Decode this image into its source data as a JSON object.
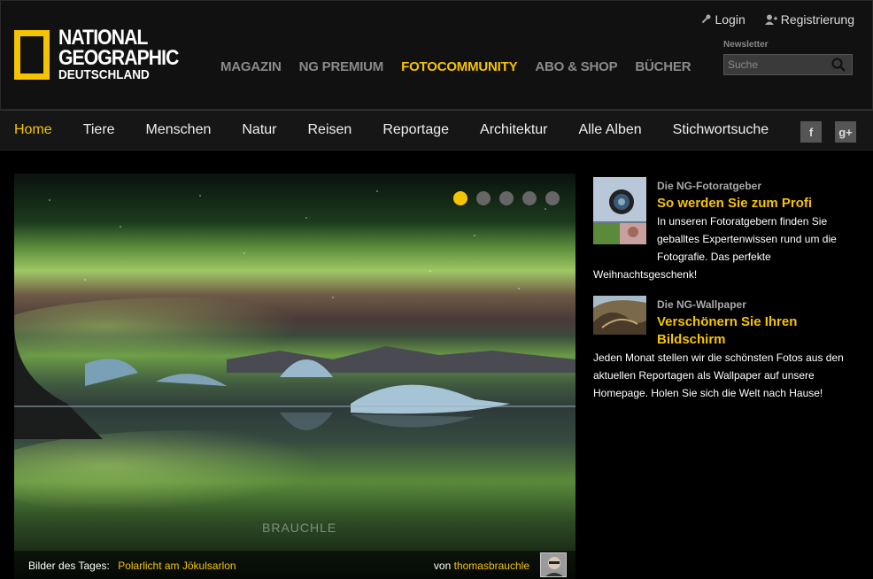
{
  "brand": {
    "line1": "NATIONAL",
    "line2": "GEOGRAPHIC",
    "line3": "DEUTSCHLAND",
    "accent": "#f5c400"
  },
  "topnav": [
    {
      "label": "MAGAZIN"
    },
    {
      "label": "NG PREMIUM"
    },
    {
      "label": "FOTOCOMMUNITY",
      "active": true
    },
    {
      "label": "ABO & SHOP"
    },
    {
      "label": "BÜCHER"
    }
  ],
  "user": {
    "login": "Login",
    "register": "Registrierung"
  },
  "newsletter": {
    "label": "Newsletter",
    "placeholder": "Suche"
  },
  "catnav": [
    {
      "label": "Home",
      "active": true
    },
    {
      "label": "Tiere"
    },
    {
      "label": "Menschen"
    },
    {
      "label": "Natur"
    },
    {
      "label": "Reisen"
    },
    {
      "label": "Reportage"
    },
    {
      "label": "Architektur"
    },
    {
      "label": "Alle Alben"
    },
    {
      "label": "Stichwortsuche"
    }
  ],
  "social": {
    "facebook": "f",
    "googleplus": "g+"
  },
  "slider": {
    "slides_count": 5,
    "active_index": 0,
    "caption_prefix": "Bilder des Tages:",
    "caption_title": "Polarlicht am Jökulsarlon",
    "by_prefix": "von",
    "author": "thomasbrauchle",
    "watermark": "BRAUCHLE"
  },
  "teasers": [
    {
      "kicker": "Die NG-Fotoratgeber",
      "headline": "So werden Sie zum Profi",
      "body": "In unseren Fotoratgebern finden Sie geballtes Expertenwissen rund um die Fotografie. Das perfekte Weihnachtsgeschenk!"
    },
    {
      "kicker": "Die NG-Wallpaper",
      "headline": "Verschönern Sie Ihren Bildschirm",
      "body": "Jeden Monat stellen wir die schönsten Fotos aus den aktuellen Reportagen als Wallpaper auf unsere Homepage. Holen Sie sich die Welt nach Hause!"
    }
  ]
}
